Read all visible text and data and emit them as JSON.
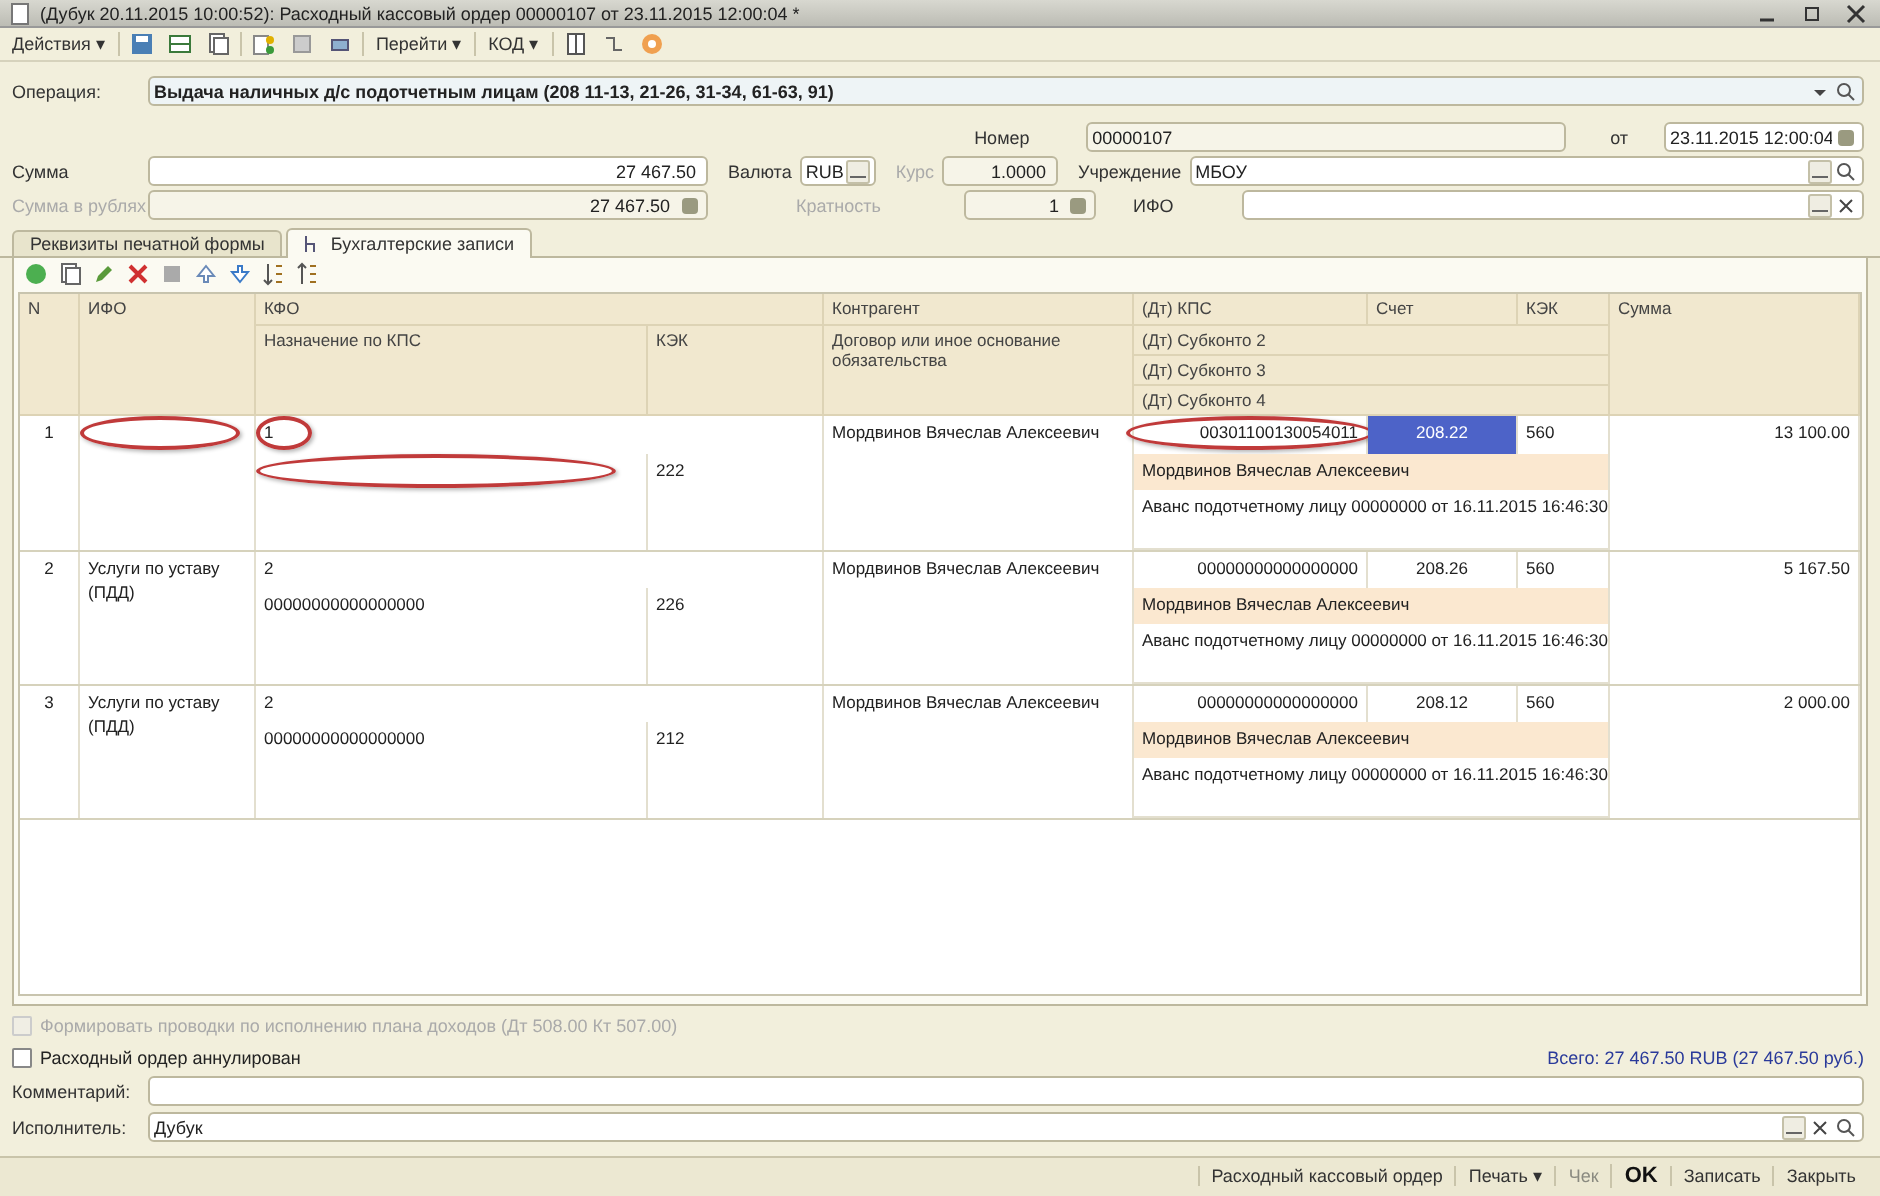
{
  "window": {
    "title": "(Дубук 20.11.2015 10:00:52): Расходный кассовый ордер 00000107 от 23.11.2015 12:00:04 *"
  },
  "toolbar": {
    "menus": [
      "Действия ▾",
      "Перейти ▾",
      "КОД ▾"
    ]
  },
  "form": {
    "operation": {
      "label": "Операция:",
      "value": "Выдача наличных д/с подотчетным лицам (208 11-13, 21-26, 31-34, 61-63, 91)"
    },
    "number": {
      "label": "Номер",
      "value": "00000107"
    },
    "date": {
      "label": "от",
      "value": "23.11.2015 12:00:04"
    },
    "sum": {
      "label": "Сумма",
      "value": "27 467.50"
    },
    "currency": {
      "label": "Валюта",
      "value": "RUB"
    },
    "rate": {
      "label": "Курс",
      "value": "1.0000"
    },
    "institution": {
      "label": "Учреждение",
      "value": "МБОУ"
    },
    "sum_rub": {
      "label": "Сумма в рублях",
      "value": "27 467.50"
    },
    "multiplicity": {
      "label": "Кратность",
      "value": "1"
    },
    "ifo": {
      "label": "ИФО"
    }
  },
  "tabs": [
    {
      "label": "Реквизиты печатной формы",
      "selected": false
    },
    {
      "label": "Бухгалтерские записи",
      "selected": true
    }
  ],
  "table": {
    "header": {
      "n": "N",
      "ifo": "ИФО",
      "kfo": "КФО",
      "purpose": "Назначение по КПС",
      "kek": "КЭК",
      "counterparty": "Контрагент",
      "contract": "Договор или иное основание обязательства",
      "dt_kps": "(Дт) КПС",
      "account": "Счет",
      "kek2": "КЭК",
      "subkonto2": "(Дт) Субконто 2",
      "subkonto3": "(Дт) Субконто 3",
      "subkonto4": "(Дт) Субконто 4",
      "sum": "Сумма"
    },
    "rows": [
      {
        "n": "1",
        "ifo": "",
        "kfo": "1",
        "kps": "",
        "kek": "222",
        "counterparty": "Мордвинов Вячеслав Алексеевич",
        "dt_kps": "00301100130054011",
        "account": "208.22",
        "account_selected": true,
        "kek2": "560",
        "subkonto2": "Мордвинов Вячеслав Алексеевич",
        "subkonto3": "Аванс подотчетному лицу 00000000 от 16.11.2015 16:46:30",
        "sum": "13 100.00",
        "ifo_circled": true,
        "kfo_circled": true,
        "kps_circled": true,
        "dt_kps_circled": true
      },
      {
        "n": "2",
        "ifo": "Услуги по уставу (ПДД)",
        "kfo": "2",
        "kps": "00000000000000000",
        "kek": "226",
        "counterparty": "Мордвинов Вячеслав Алексеевич",
        "dt_kps": "00000000000000000",
        "account": "208.26",
        "account_selected": false,
        "kek2": "560",
        "subkonto2": "Мордвинов Вячеслав Алексеевич",
        "subkonto3": "Аванс подотчетному лицу 00000000 от 16.11.2015 16:46:30",
        "sum": "5 167.50",
        "ifo_circled": false,
        "kfo_circled": false,
        "kps_circled": false,
        "dt_kps_circled": false
      },
      {
        "n": "3",
        "ifo": "Услуги по уставу (ПДД)",
        "kfo": "2",
        "kps": "00000000000000000",
        "kek": "212",
        "counterparty": "Мордвинов Вячеслав Алексеевич",
        "dt_kps": "00000000000000000",
        "account": "208.12",
        "account_selected": false,
        "kek2": "560",
        "subkonto2": "Мордвинов Вячеслав Алексеевич",
        "subkonto3": "Аванс подотчетному лицу 00000000 от 16.11.2015 16:46:30",
        "sum": "2 000.00",
        "ifo_circled": false,
        "kfo_circled": false,
        "kps_circled": false,
        "dt_kps_circled": false
      }
    ]
  },
  "footer": {
    "plan": {
      "label": "Формировать проводки по исполнению плана доходов (Дт 508.00 Кт 507.00)",
      "checked": false,
      "disabled": true
    },
    "annulled": {
      "label": "Расходный ордер аннулирован",
      "checked": false,
      "disabled": false
    },
    "total": "Всего: 27 467.50 RUB (27 467.50 руб.)",
    "comment": {
      "label": "Комментарий:"
    },
    "executor": {
      "label": "Исполнитель:",
      "value": "Дубук"
    }
  },
  "status_bar": [
    {
      "label": "Расходный кассовый ордер",
      "kind": "plain",
      "disabled": false
    },
    {
      "label": "Печать ▾",
      "kind": "menu",
      "disabled": false
    },
    {
      "label": "Чек",
      "kind": "plain",
      "disabled": true
    },
    {
      "label": "OK",
      "kind": "default",
      "disabled": false
    },
    {
      "label": "Записать",
      "kind": "plain",
      "disabled": false
    },
    {
      "label": "Закрыть",
      "kind": "plain",
      "disabled": false
    }
  ]
}
